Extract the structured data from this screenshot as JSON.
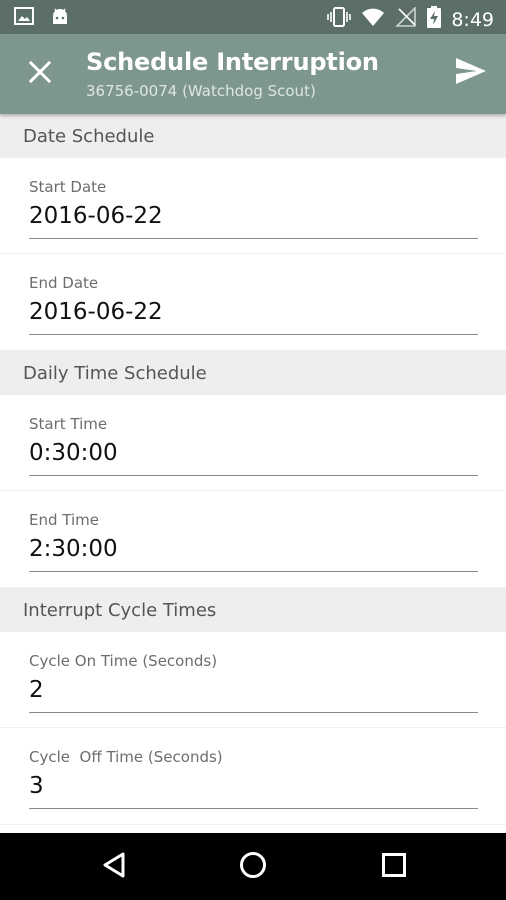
{
  "status_bar": {
    "time": "8:49",
    "icons": [
      "image-icon",
      "android-icon",
      "vibrate-icon",
      "wifi-icon",
      "no-signal-icon",
      "battery-charging-icon"
    ]
  },
  "app_bar": {
    "title": "Schedule Interruption",
    "subtitle": "36756-0074 (Watchdog Scout)",
    "close_icon": "close-icon",
    "send_icon": "send-icon"
  },
  "sections": {
    "date": {
      "header": "Date Schedule",
      "start": {
        "label": "Start Date",
        "value": "2016-06-22"
      },
      "end": {
        "label": "End Date",
        "value": "2016-06-22"
      }
    },
    "time": {
      "header": "Daily Time Schedule",
      "start": {
        "label": "Start Time",
        "value": "0:30:00"
      },
      "end": {
        "label": "End Time",
        "value": "2:30:00"
      }
    },
    "cycle": {
      "header": "Interrupt Cycle Times",
      "on": {
        "label": "Cycle On Time (Seconds)",
        "value": "2"
      },
      "off": {
        "label": "Cycle  Off Time (Seconds)",
        "value": "3"
      }
    }
  },
  "nav_bar": {
    "icons": [
      "back-icon",
      "home-icon",
      "recents-icon"
    ]
  },
  "colors": {
    "status_bar": "#5b6f66",
    "app_bar": "#7e9690",
    "section_header_bg": "#eeeeee"
  }
}
